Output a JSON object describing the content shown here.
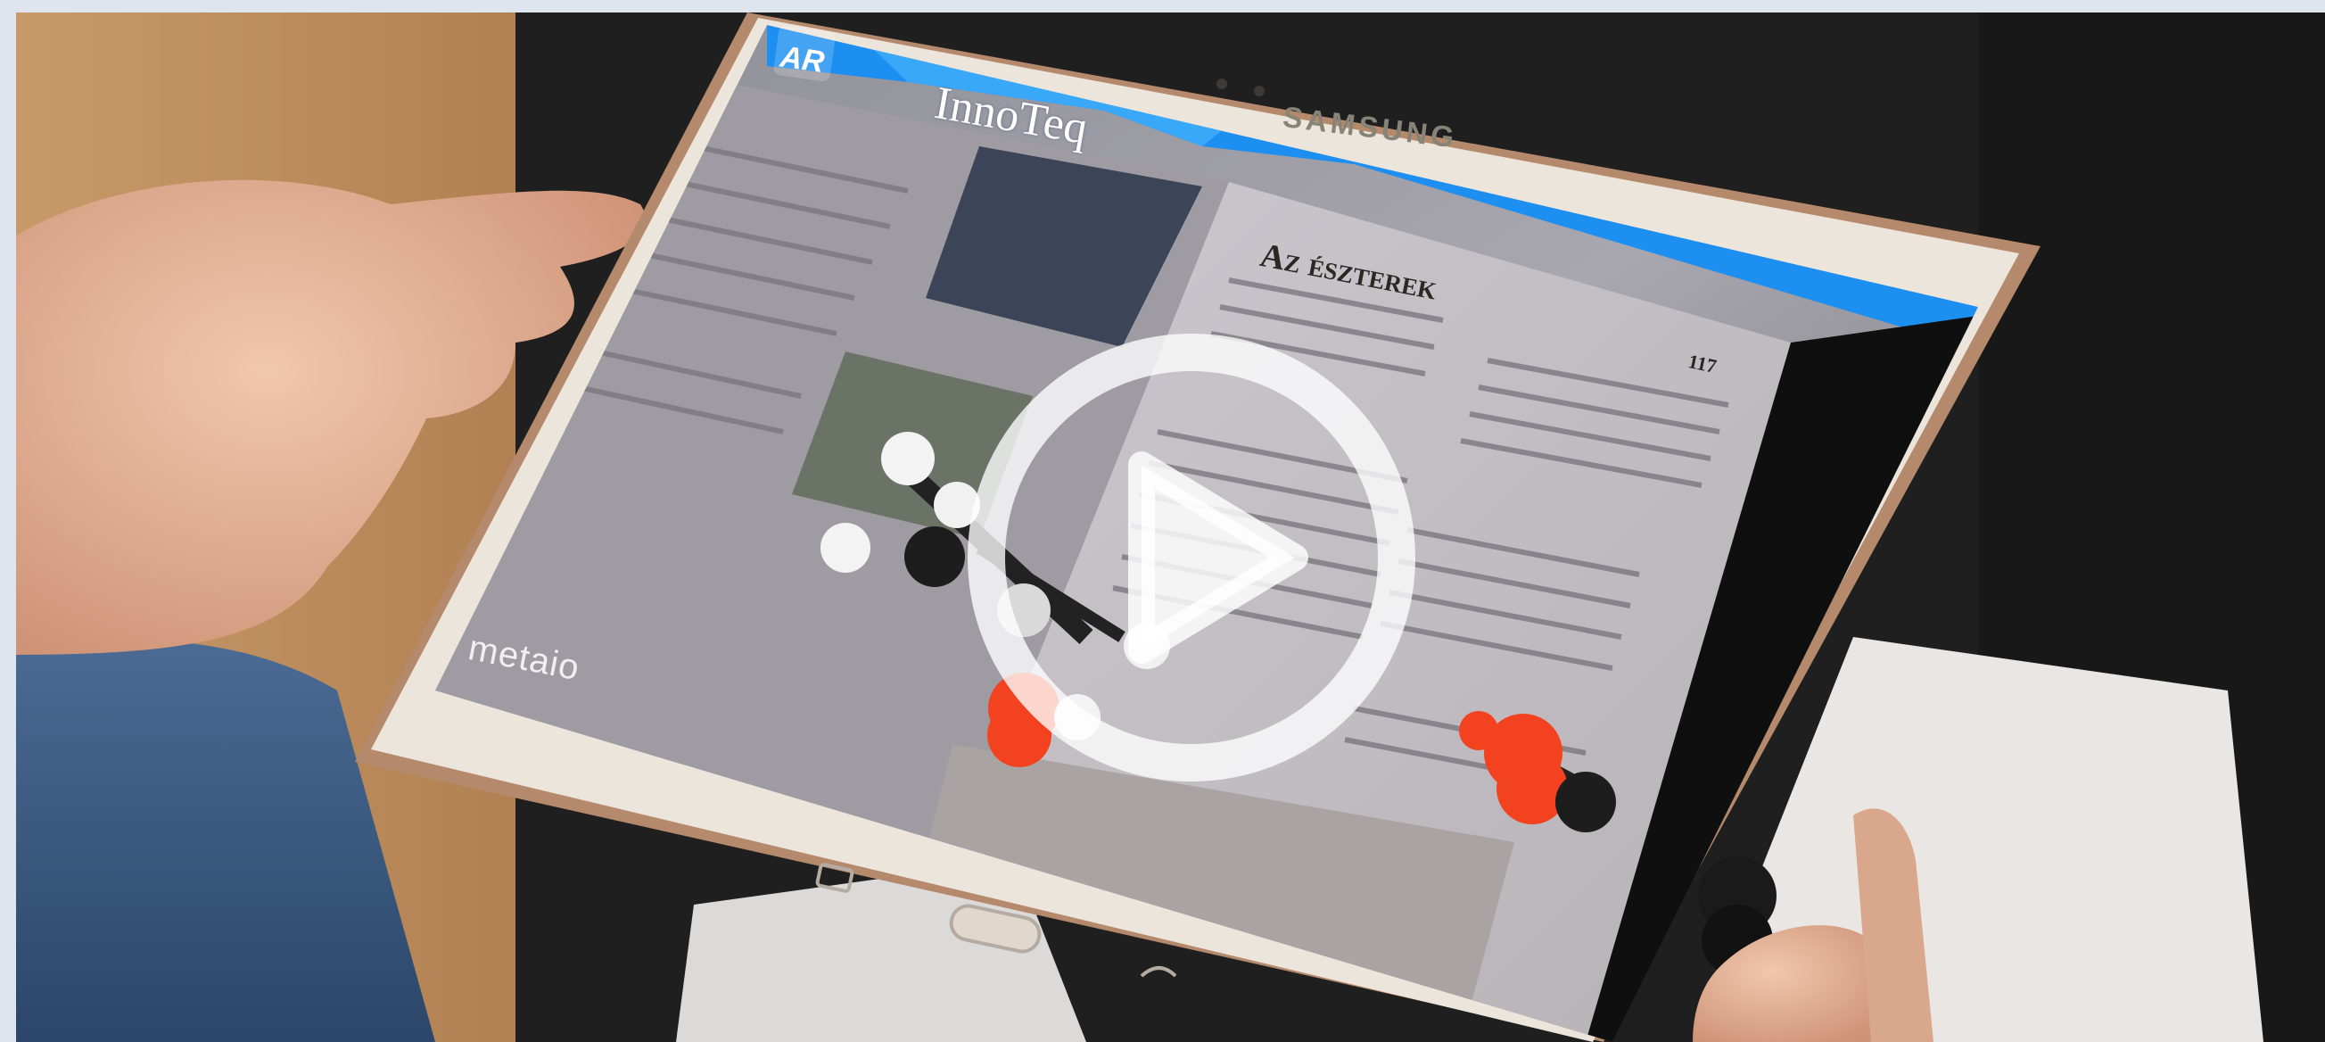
{
  "video": {
    "scene_description_hidden": "",
    "tablet_brand": "SAMSUNG",
    "app_badge": "AR",
    "app_logo": "InnoTeq",
    "watermark": "metaio",
    "book_heading": "Az észterek",
    "page_number": "117",
    "play_icon": "play-circle-icon"
  },
  "colors": {
    "page_background": "#dfe5ee",
    "app_header_blue": "#1c8ff0",
    "molecule_red": "#f2421f",
    "play_overlay": "rgba(255,255,255,0.75)"
  }
}
